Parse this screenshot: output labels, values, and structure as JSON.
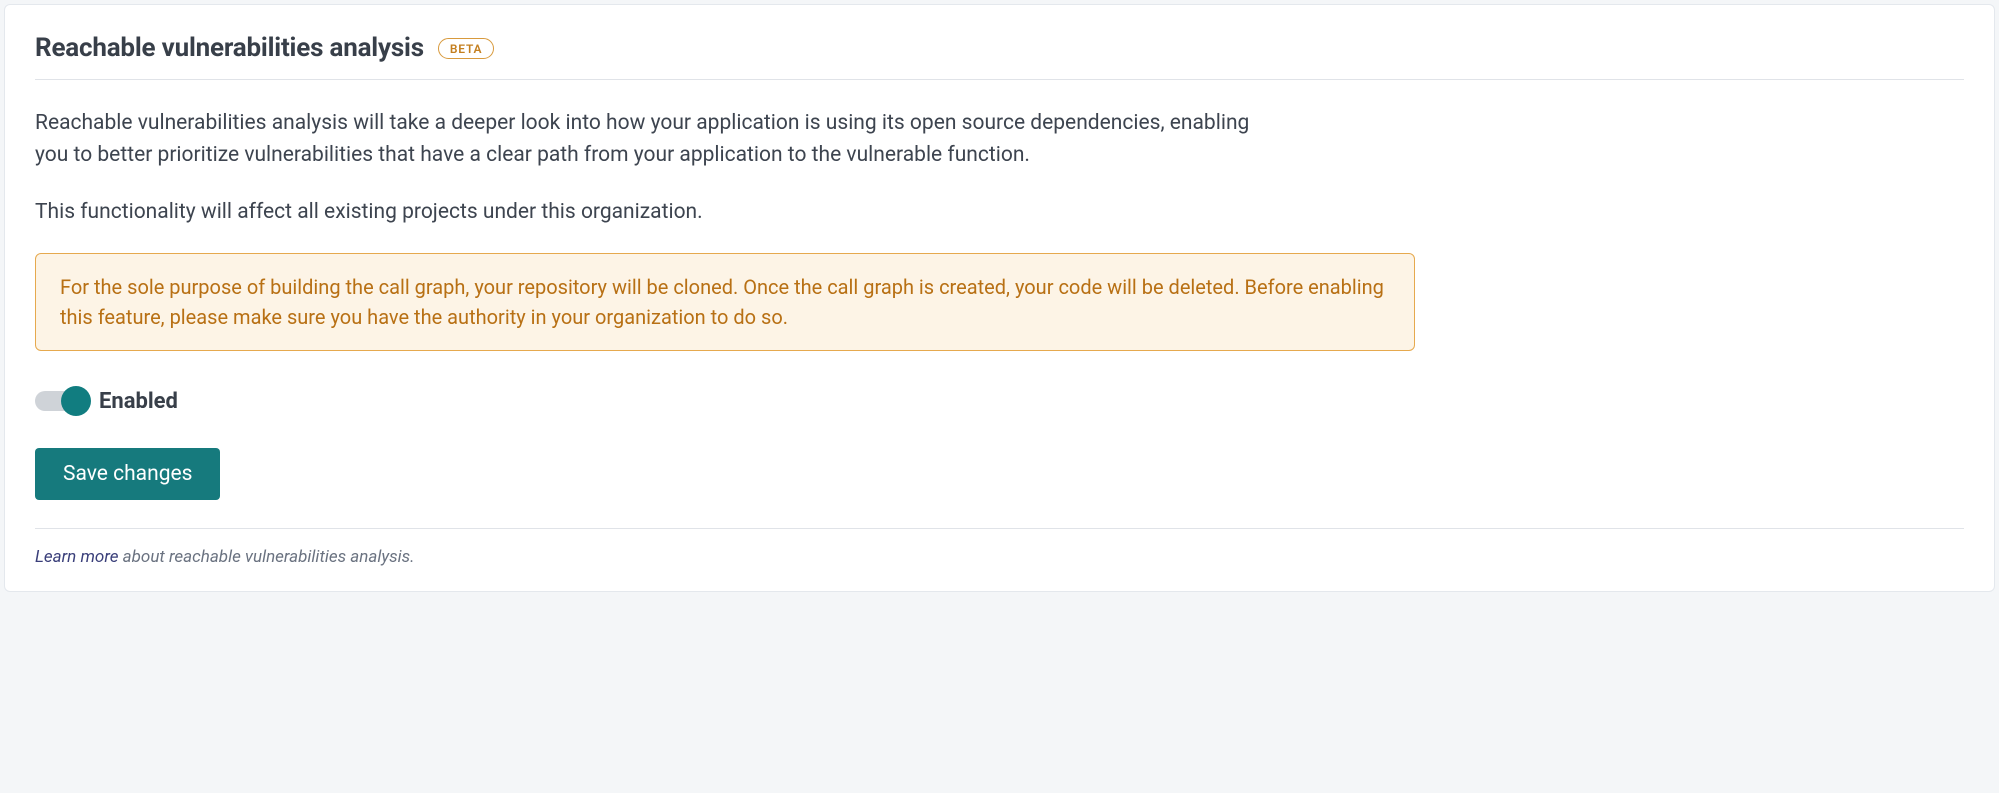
{
  "header": {
    "title": "Reachable vulnerabilities analysis",
    "badge": "BETA"
  },
  "description": {
    "p1": "Reachable vulnerabilities analysis will take a deeper look into how your application is using its open source dependencies, enabling you to better prioritize vulnerabilities that have a clear path from your application to the vulnerable function.",
    "p2": "This functionality will affect all existing projects under this organization."
  },
  "warning": "For the sole purpose of building the call graph, your repository will be cloned. Once the call graph is created, your code will be deleted. Before enabling this feature, please make sure you have the authority in your organization to do so.",
  "toggle": {
    "label": "Enabled",
    "checked": true
  },
  "actions": {
    "save": "Save changes"
  },
  "footer": {
    "link": "Learn more",
    "text": " about reachable vulnerabilities analysis."
  }
}
